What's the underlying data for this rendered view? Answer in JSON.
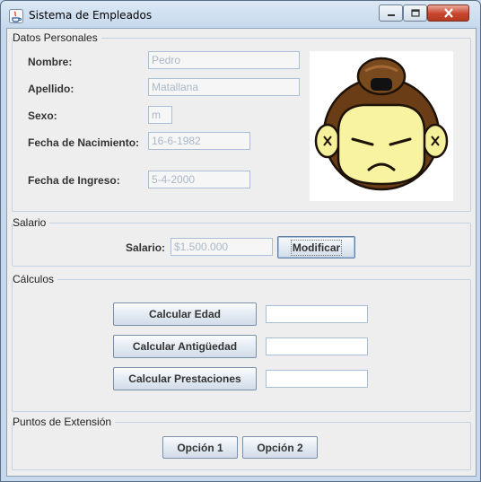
{
  "window": {
    "title": "Sistema de Empleados",
    "controls": {
      "minimize": "minimize",
      "maximize": "maximize",
      "close": "close"
    }
  },
  "datos_personales": {
    "title": "Datos Personales",
    "fields": [
      {
        "label": "Nombre:",
        "value": "Pedro"
      },
      {
        "label": "Apellido:",
        "value": "Matallana"
      },
      {
        "label": "Sexo:",
        "value": "m"
      },
      {
        "label": "Fecha de Nacimiento:",
        "value": "16-6-1982"
      },
      {
        "label": "Fecha de Ingreso:",
        "value": "5-4-2000"
      }
    ],
    "photo_icon": "sumo-face-icon"
  },
  "salario": {
    "title": "Salario",
    "label": "Salario:",
    "value": "$1.500.000",
    "button": "Modificar"
  },
  "calculos": {
    "title": "Cálculos",
    "buttons": [
      "Calcular Edad",
      "Calcular Antigüedad",
      "Calcular Prestaciones"
    ],
    "results": [
      "",
      "",
      ""
    ]
  },
  "extension": {
    "title": "Puntos de Extensión",
    "buttons": [
      "Opción 1",
      "Opción 2"
    ]
  },
  "colors": {
    "title_bar": "#c6d9ec",
    "panel_bg": "#eeeeee",
    "close_button": "#c8442c",
    "disabled_text": "#aab8c6"
  }
}
